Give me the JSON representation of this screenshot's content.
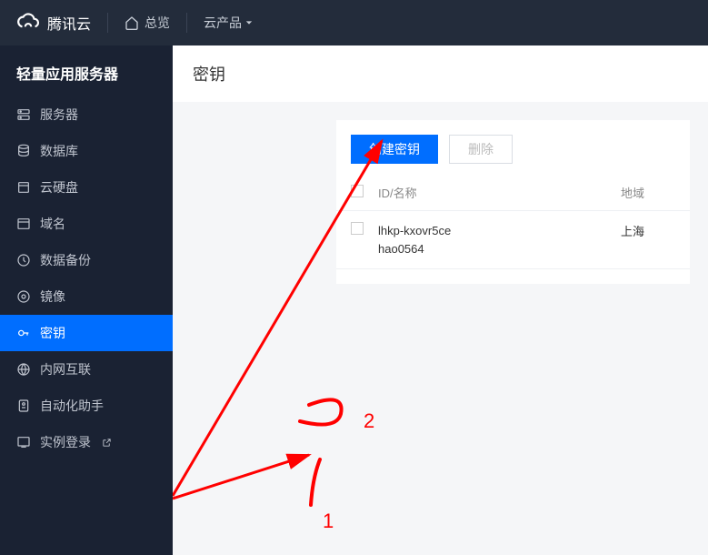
{
  "topbar": {
    "brand": "腾讯云",
    "overview": "总览",
    "products": "云产品"
  },
  "sidebar": {
    "title": "轻量应用服务器",
    "items": [
      {
        "label": "服务器",
        "name": "nav-server"
      },
      {
        "label": "数据库",
        "name": "nav-database"
      },
      {
        "label": "云硬盘",
        "name": "nav-disk"
      },
      {
        "label": "域名",
        "name": "nav-domain"
      },
      {
        "label": "数据备份",
        "name": "nav-backup"
      },
      {
        "label": "镜像",
        "name": "nav-image"
      },
      {
        "label": "密钥",
        "name": "nav-key",
        "active": true
      },
      {
        "label": "内网互联",
        "name": "nav-intranet"
      },
      {
        "label": "自动化助手",
        "name": "nav-automation"
      },
      {
        "label": "实例登录",
        "name": "nav-login",
        "external": true
      }
    ]
  },
  "page": {
    "title": "密钥",
    "create_btn": "创建密钥",
    "delete_btn": "删除",
    "col_id": "ID/名称",
    "col_region": "地域",
    "rows": [
      {
        "id": "lhkp-kxovr5ce",
        "name": "hao0564",
        "region": "上海"
      }
    ]
  },
  "annotations": {
    "num1": "1",
    "num2": "2"
  }
}
